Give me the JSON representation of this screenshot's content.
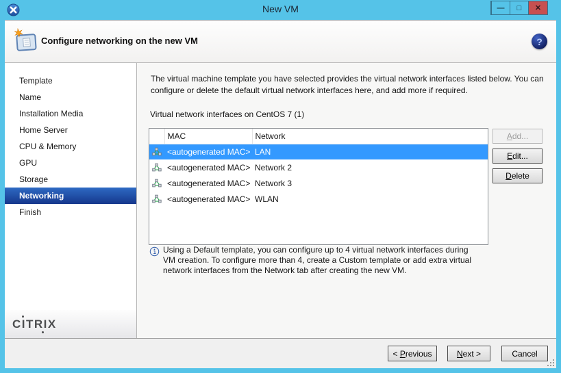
{
  "window": {
    "title": "New VM",
    "controls": [
      {
        "name": "minimize-button",
        "glyph": "—"
      },
      {
        "name": "maximize-button",
        "glyph": "□"
      },
      {
        "name": "close-button",
        "glyph": "✕"
      }
    ]
  },
  "header": {
    "title": "Configure networking on the new VM",
    "help_glyph": "?"
  },
  "sidebar": {
    "items": [
      {
        "name": "sidebar-item-template",
        "label": "Template"
      },
      {
        "name": "sidebar-item-name",
        "label": "Name"
      },
      {
        "name": "sidebar-item-installation-media",
        "label": "Installation Media"
      },
      {
        "name": "sidebar-item-home-server",
        "label": "Home Server"
      },
      {
        "name": "sidebar-item-cpu-memory",
        "label": "CPU & Memory"
      },
      {
        "name": "sidebar-item-gpu",
        "label": "GPU"
      },
      {
        "name": "sidebar-item-storage",
        "label": "Storage"
      },
      {
        "name": "sidebar-item-networking",
        "label": "Networking",
        "active": true
      },
      {
        "name": "sidebar-item-finish",
        "label": "Finish"
      }
    ],
    "logo_text": "CITRIX"
  },
  "main": {
    "description": "The virtual machine template you have selected provides the virtual network interfaces listed below. You can configure or delete the default virtual network interfaces here, and add more if required.",
    "list_label": "Virtual network interfaces on CentOS 7 (1)",
    "table": {
      "columns": {
        "mac": "MAC",
        "network": "Network"
      },
      "rows": [
        {
          "mac": "<autogenerated MAC>",
          "network": "LAN",
          "selected": true
        },
        {
          "mac": "<autogenerated MAC>",
          "network": "Network 2",
          "selected": false
        },
        {
          "mac": "<autogenerated MAC>",
          "network": "Network 3",
          "selected": false
        },
        {
          "mac": "<autogenerated MAC>",
          "network": "WLAN",
          "selected": false
        }
      ]
    },
    "side_buttons": [
      {
        "name": "add-button",
        "pre": "",
        "key": "A",
        "post": "dd...",
        "disabled": true
      },
      {
        "name": "edit-button",
        "pre": "",
        "key": "E",
        "post": "dit...",
        "disabled": false
      },
      {
        "name": "delete-button",
        "pre": "",
        "key": "D",
        "post": "elete",
        "disabled": false
      }
    ],
    "info": "Using a Default template, you can configure up to 4 virtual network interfaces during VM creation. To configure more than 4, create a Custom template or add extra virtual network interfaces from the Network tab after creating the new VM."
  },
  "footer": {
    "previous": {
      "pre": "< ",
      "key": "P",
      "post": "revious"
    },
    "next": {
      "pre": "",
      "key": "N",
      "post": "ext >"
    },
    "cancel": {
      "pre": "Cancel",
      "key": "",
      "post": ""
    }
  },
  "colors": {
    "titlebar_blue": "#55c3e8",
    "close_red": "#c75050",
    "selection_blue": "#3399ff",
    "sidebar_active_top": "#2e6ac3",
    "sidebar_active_bottom": "#16378c",
    "help_navy": "#121f60",
    "net_icon_green": "#2eb052",
    "info_icon_blue": "#3a64ae"
  }
}
